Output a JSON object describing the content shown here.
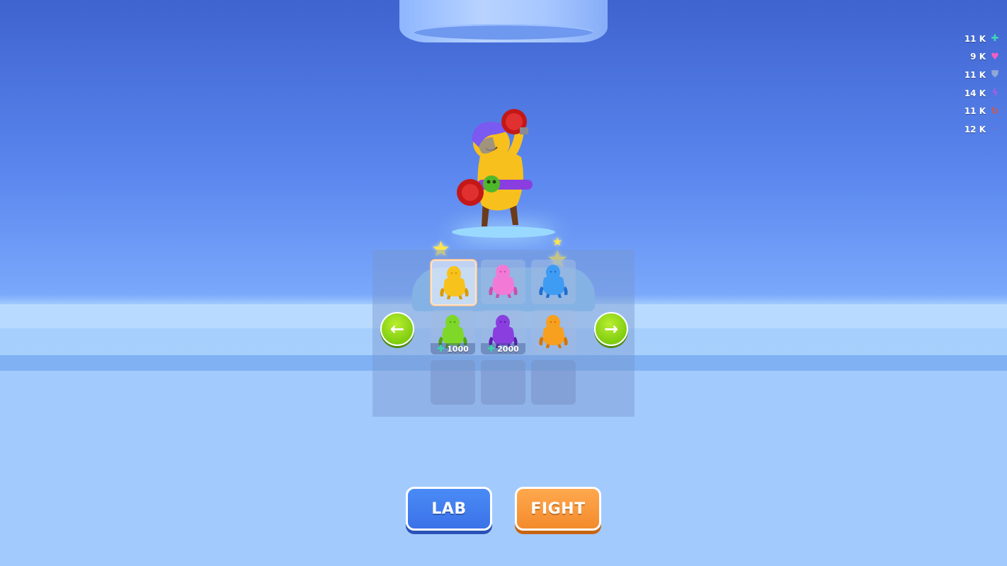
{
  "stats": [
    {
      "value": "11 K",
      "icon": "health-cross-icon",
      "color": "#3dd9b4",
      "glyph": "✚"
    },
    {
      "value": "9 K",
      "icon": "heart-icon",
      "color": "#f25fc0",
      "glyph": "♥"
    },
    {
      "value": "11 K",
      "icon": "shield-icon",
      "color": "#8fa8d8",
      "glyph": "⛊"
    },
    {
      "value": "14 K",
      "icon": "lightning-icon",
      "color": "#b05be6",
      "glyph": "ϟ"
    },
    {
      "value": "11 K",
      "icon": "swirl-icon",
      "color": "#e0553a",
      "glyph": "↻"
    },
    {
      "value": "12 K",
      "icon": "speed-chevrons-icon",
      "color": "#6b76d8",
      "glyph": "«"
    }
  ],
  "characters": [
    {
      "color": "#f7c21b",
      "shade": "#d99a00",
      "selected": true,
      "locked": false
    },
    {
      "color": "#f27ad6",
      "shade": "#c94fb0",
      "selected": false,
      "locked": false
    },
    {
      "color": "#3f9cf3",
      "shade": "#1f6fd0",
      "selected": false,
      "locked": false
    },
    {
      "color": "#7fd72a",
      "shade": "#4fa512",
      "selected": false,
      "locked": true,
      "price": "1000"
    },
    {
      "color": "#8a3ee0",
      "shade": "#5c1fb0",
      "selected": false,
      "locked": true,
      "price": "2000"
    },
    {
      "color": "#f7a020",
      "shade": "#d57500",
      "selected": false,
      "locked": false
    }
  ],
  "buttons": {
    "lab": "LAB",
    "fight": "FIGHT"
  }
}
